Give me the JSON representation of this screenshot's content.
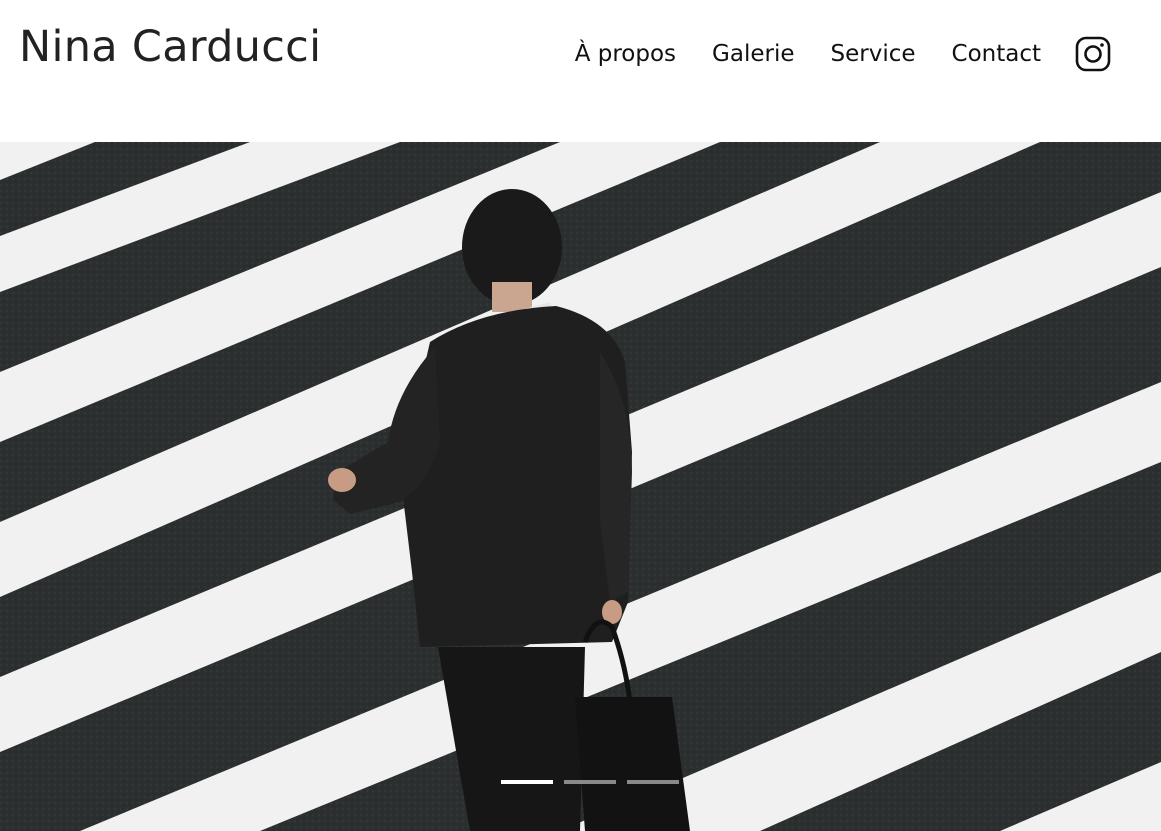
{
  "site": {
    "brand": "Nina Carducci"
  },
  "nav": {
    "items": [
      {
        "label": "À propos"
      },
      {
        "label": "Galerie"
      },
      {
        "label": "Service"
      },
      {
        "label": "Contact"
      }
    ],
    "instagram_icon": "instagram-icon"
  },
  "hero": {
    "image": "man-in-suit-crossing-crosswalk",
    "slides_count": 3,
    "active_slide": 1
  },
  "colors": {
    "text": "#1f1f1f",
    "asphalt": "#2b2e2e",
    "stripe": "#f2f2f2"
  }
}
